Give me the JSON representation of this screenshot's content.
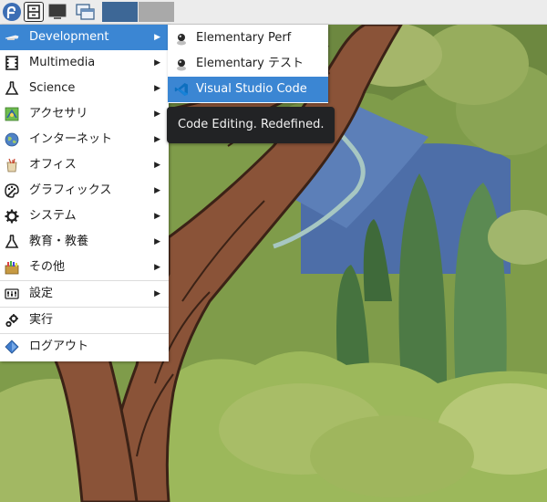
{
  "panel": {
    "launcher_icon": "fedora-icon",
    "files_icon": "file-cabinet-icon",
    "terminal_icon": "monitor-icon",
    "windows_icon": "windows-icon",
    "workspace_colors": [
      "#3d6796",
      "#a9a9a9"
    ]
  },
  "menu": {
    "items": [
      {
        "label": "Development",
        "icon": "development-icon",
        "submenu": true,
        "active": true
      },
      {
        "label": "Multimedia",
        "icon": "multimedia-icon",
        "submenu": true
      },
      {
        "label": "Science",
        "icon": "science-flask-icon",
        "submenu": true
      },
      {
        "label": "アクセサリ",
        "icon": "accessories-icon",
        "submenu": true
      },
      {
        "label": "インターネット",
        "icon": "internet-globe-icon",
        "submenu": true
      },
      {
        "label": "オフィス",
        "icon": "office-icon",
        "submenu": true
      },
      {
        "label": "グラフィックス",
        "icon": "graphics-palette-icon",
        "submenu": true
      },
      {
        "label": "システム",
        "icon": "system-gear-icon",
        "submenu": true
      },
      {
        "label": "教育・教養",
        "icon": "education-flask-icon",
        "submenu": true
      },
      {
        "label": "その他",
        "icon": "other-box-icon",
        "submenu": true
      },
      {
        "label": "設定",
        "icon": "settings-icon",
        "submenu": true
      },
      {
        "label": "実行",
        "icon": "run-gears-icon",
        "submenu": false
      },
      {
        "label": "ログアウト",
        "icon": "logout-icon",
        "submenu": false
      }
    ]
  },
  "submenu": {
    "items": [
      {
        "label": "Elementary Perf",
        "icon": "elementary-icon"
      },
      {
        "label": "Elementary テスト",
        "icon": "elementary-icon"
      },
      {
        "label": "Visual Studio Code",
        "icon": "vscode-icon",
        "active": true
      }
    ]
  },
  "tooltip": {
    "text": "Code Editing. Redefined."
  },
  "colors": {
    "highlight": "#3b86d3",
    "tooltip_bg": "#222325"
  }
}
